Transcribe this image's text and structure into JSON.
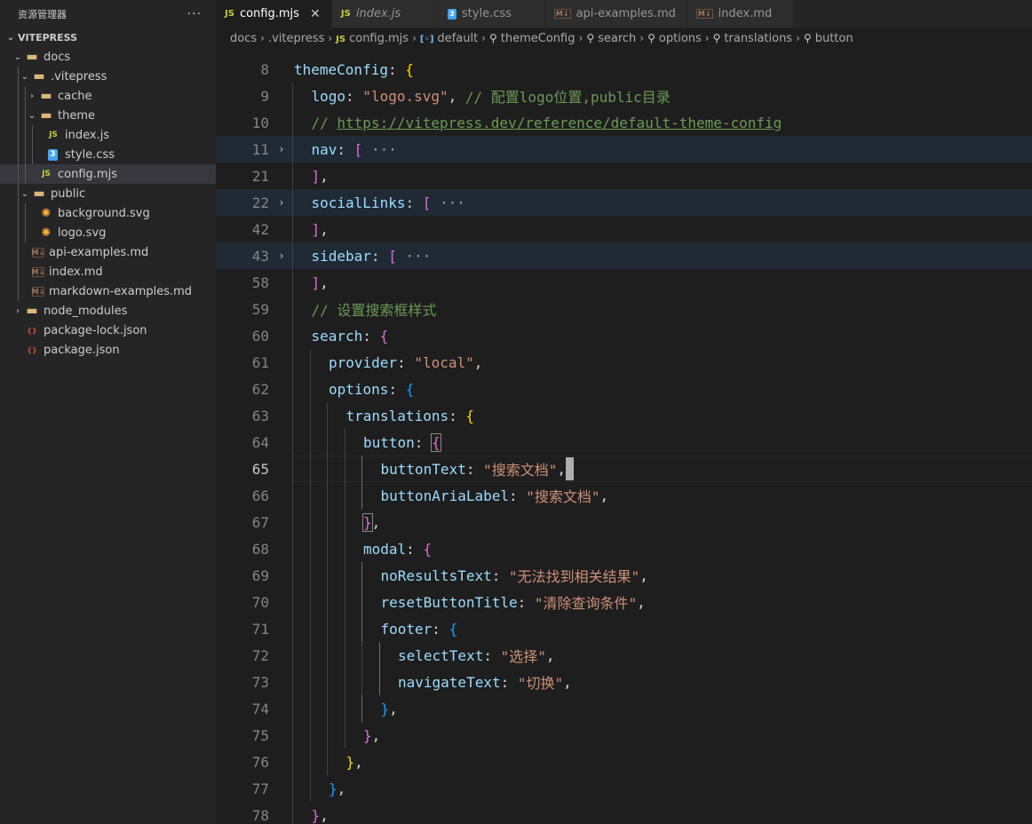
{
  "sidebar": {
    "title": "资源管理器",
    "more": "···",
    "root": "VITEPRESS",
    "items": [
      {
        "label": "docs",
        "depth": 1,
        "kind": "folder",
        "open": true
      },
      {
        "label": ".vitepress",
        "depth": 2,
        "kind": "folder",
        "open": true
      },
      {
        "label": "cache",
        "depth": 3,
        "kind": "folder",
        "open": false
      },
      {
        "label": "theme",
        "depth": 3,
        "kind": "folder",
        "open": true
      },
      {
        "label": "index.js",
        "depth": 4,
        "kind": "js"
      },
      {
        "label": "style.css",
        "depth": 4,
        "kind": "css"
      },
      {
        "label": "config.mjs",
        "depth": 3,
        "kind": "js",
        "selected": true
      },
      {
        "label": "public",
        "depth": 2,
        "kind": "folder",
        "open": true
      },
      {
        "label": "background.svg",
        "depth": 3,
        "kind": "svg"
      },
      {
        "label": "logo.svg",
        "depth": 3,
        "kind": "svg"
      },
      {
        "label": "api-examples.md",
        "depth": 2,
        "kind": "md"
      },
      {
        "label": "index.md",
        "depth": 2,
        "kind": "md"
      },
      {
        "label": "markdown-examples.md",
        "depth": 2,
        "kind": "md"
      },
      {
        "label": "node_modules",
        "depth": 1,
        "kind": "folder",
        "open": false
      },
      {
        "label": "package-lock.json",
        "depth": 1,
        "kind": "json"
      },
      {
        "label": "package.json",
        "depth": 1,
        "kind": "json"
      }
    ]
  },
  "tabs": [
    {
      "label": "config.mjs",
      "kind": "js",
      "active": true,
      "close": "✕"
    },
    {
      "label": "index.js",
      "kind": "js",
      "italic": true
    },
    {
      "label": "style.css",
      "kind": "css"
    },
    {
      "label": "api-examples.md",
      "kind": "md"
    },
    {
      "label": "index.md",
      "kind": "md"
    }
  ],
  "breadcrumb": [
    {
      "label": "docs",
      "icon": ""
    },
    {
      "label": ".vitepress",
      "icon": ""
    },
    {
      "label": "config.mjs",
      "icon": "js"
    },
    {
      "label": "default",
      "icon": "obj"
    },
    {
      "label": "themeConfig",
      "icon": "wrench"
    },
    {
      "label": "search",
      "icon": "wrench"
    },
    {
      "label": "options",
      "icon": "wrench"
    },
    {
      "label": "translations",
      "icon": "wrench"
    },
    {
      "label": "button",
      "icon": "wrench"
    }
  ],
  "editor": {
    "current_line": "65",
    "lines": [
      {
        "n": "8",
        "indent": 1,
        "tokens": [
          [
            "k",
            "themeConfig"
          ],
          [
            "p",
            ": "
          ],
          [
            "b1",
            "{"
          ]
        ]
      },
      {
        "n": "9",
        "indent": 2,
        "tokens": [
          [
            "k",
            "logo"
          ],
          [
            "p",
            ": "
          ],
          [
            "s",
            "\"logo.svg\""
          ],
          [
            "p",
            ", "
          ],
          [
            "c",
            "// 配置logo位置,public目录"
          ]
        ]
      },
      {
        "n": "10",
        "indent": 2,
        "tokens": [
          [
            "c",
            "// "
          ],
          [
            "cl",
            "https://vitepress.dev/reference/default-theme-config"
          ]
        ]
      },
      {
        "n": "11",
        "indent": 2,
        "fold": "›",
        "folded": true,
        "tokens": [
          [
            "k",
            "nav"
          ],
          [
            "p",
            ": "
          ],
          [
            "b2",
            "["
          ],
          [
            "ell",
            " ···"
          ]
        ]
      },
      {
        "n": "21",
        "indent": 2,
        "tokens": [
          [
            "b2",
            "]"
          ],
          [
            "p",
            ","
          ]
        ]
      },
      {
        "n": "22",
        "indent": 2,
        "fold": "›",
        "folded": true,
        "tokens": [
          [
            "k",
            "socialLinks"
          ],
          [
            "p",
            ": "
          ],
          [
            "b2",
            "["
          ],
          [
            "ell",
            " ···"
          ]
        ]
      },
      {
        "n": "42",
        "indent": 2,
        "tokens": [
          [
            "b2",
            "]"
          ],
          [
            "p",
            ","
          ]
        ]
      },
      {
        "n": "43",
        "indent": 2,
        "fold": "›",
        "folded": true,
        "tokens": [
          [
            "k",
            "sidebar"
          ],
          [
            "p",
            ": "
          ],
          [
            "b2",
            "["
          ],
          [
            "ell",
            " ···"
          ]
        ]
      },
      {
        "n": "58",
        "indent": 2,
        "tokens": [
          [
            "b2",
            "]"
          ],
          [
            "p",
            ","
          ]
        ]
      },
      {
        "n": "59",
        "indent": 2,
        "tokens": [
          [
            "c",
            "// 设置搜索框样式"
          ]
        ]
      },
      {
        "n": "60",
        "indent": 2,
        "tokens": [
          [
            "k",
            "search"
          ],
          [
            "p",
            ": "
          ],
          [
            "b2",
            "{"
          ]
        ]
      },
      {
        "n": "61",
        "indent": 3,
        "tokens": [
          [
            "k",
            "provider"
          ],
          [
            "p",
            ": "
          ],
          [
            "s",
            "\"local\""
          ],
          [
            "p",
            ","
          ]
        ]
      },
      {
        "n": "62",
        "indent": 3,
        "tokens": [
          [
            "k",
            "options"
          ],
          [
            "p",
            ": "
          ],
          [
            "b3",
            "{"
          ]
        ]
      },
      {
        "n": "63",
        "indent": 4,
        "tokens": [
          [
            "k",
            "translations"
          ],
          [
            "p",
            ": "
          ],
          [
            "b1",
            "{"
          ]
        ]
      },
      {
        "n": "64",
        "indent": 5,
        "tokens": [
          [
            "k",
            "button"
          ],
          [
            "p",
            ": "
          ],
          [
            "b2m",
            "{"
          ]
        ]
      },
      {
        "n": "65",
        "indent": 6,
        "current": true,
        "tokens": [
          [
            "k",
            "buttonText"
          ],
          [
            "p",
            ": "
          ],
          [
            "s",
            "\"搜索文档\""
          ],
          [
            "p",
            ","
          ],
          [
            "cursor",
            ""
          ]
        ]
      },
      {
        "n": "66",
        "indent": 6,
        "tokens": [
          [
            "k",
            "buttonAriaLabel"
          ],
          [
            "p",
            ": "
          ],
          [
            "s",
            "\"搜索文档\""
          ],
          [
            "p",
            ","
          ]
        ]
      },
      {
        "n": "67",
        "indent": 5,
        "tokens": [
          [
            "b2m",
            "}"
          ],
          [
            "p",
            ","
          ]
        ]
      },
      {
        "n": "68",
        "indent": 5,
        "tokens": [
          [
            "k",
            "modal"
          ],
          [
            "p",
            ": "
          ],
          [
            "b2",
            "{"
          ]
        ]
      },
      {
        "n": "69",
        "indent": 6,
        "tokens": [
          [
            "k",
            "noResultsText"
          ],
          [
            "p",
            ": "
          ],
          [
            "s",
            "\"无法找到相关结果\""
          ],
          [
            "p",
            ","
          ]
        ]
      },
      {
        "n": "70",
        "indent": 6,
        "tokens": [
          [
            "k",
            "resetButtonTitle"
          ],
          [
            "p",
            ": "
          ],
          [
            "s",
            "\"清除查询条件\""
          ],
          [
            "p",
            ","
          ]
        ]
      },
      {
        "n": "71",
        "indent": 6,
        "tokens": [
          [
            "k",
            "footer"
          ],
          [
            "p",
            ": "
          ],
          [
            "b3",
            "{"
          ]
        ]
      },
      {
        "n": "72",
        "indent": 7,
        "tokens": [
          [
            "k",
            "selectText"
          ],
          [
            "p",
            ": "
          ],
          [
            "s",
            "\"选择\""
          ],
          [
            "p",
            ","
          ]
        ]
      },
      {
        "n": "73",
        "indent": 7,
        "tokens": [
          [
            "k",
            "navigateText"
          ],
          [
            "p",
            ": "
          ],
          [
            "s",
            "\"切换\""
          ],
          [
            "p",
            ","
          ]
        ]
      },
      {
        "n": "74",
        "indent": 6,
        "tokens": [
          [
            "b3",
            "}"
          ],
          [
            "p",
            ","
          ]
        ]
      },
      {
        "n": "75",
        "indent": 5,
        "tokens": [
          [
            "b2",
            "}"
          ],
          [
            "p",
            ","
          ]
        ]
      },
      {
        "n": "76",
        "indent": 4,
        "tokens": [
          [
            "b1",
            "}"
          ],
          [
            "p",
            ","
          ]
        ]
      },
      {
        "n": "77",
        "indent": 3,
        "tokens": [
          [
            "b3",
            "}"
          ],
          [
            "p",
            ","
          ]
        ]
      },
      {
        "n": "78",
        "indent": 2,
        "tokens": [
          [
            "b2",
            "}"
          ],
          [
            "p",
            ","
          ]
        ]
      }
    ]
  }
}
